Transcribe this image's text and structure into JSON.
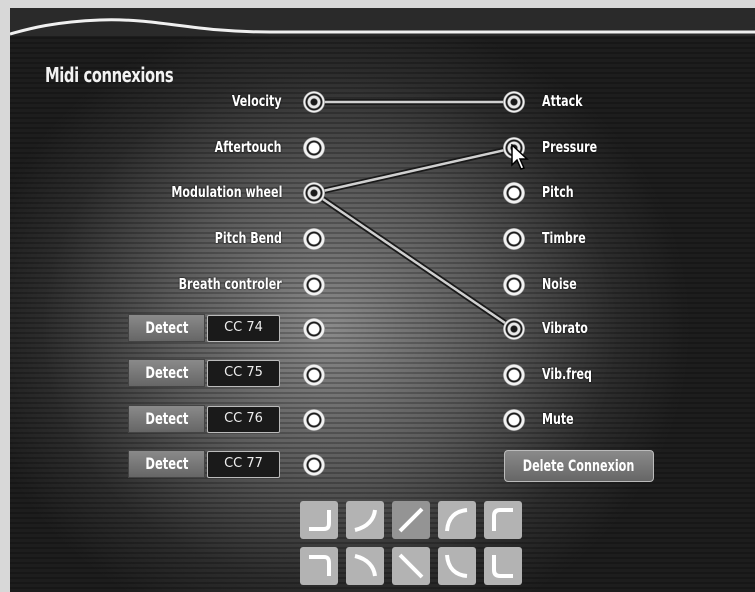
{
  "title": "Midi connexions",
  "sources": [
    {
      "label": "Velocity"
    },
    {
      "label": "Aftertouch"
    },
    {
      "label": "Modulation wheel"
    },
    {
      "label": "Pitch Bend"
    },
    {
      "label": "Breath controler"
    }
  ],
  "cc_rows": [
    {
      "detect_label": "Detect",
      "cc": "CC 74"
    },
    {
      "detect_label": "Detect",
      "cc": "CC 75"
    },
    {
      "detect_label": "Detect",
      "cc": "CC 76"
    },
    {
      "detect_label": "Detect",
      "cc": "CC 77"
    }
  ],
  "destinations": [
    {
      "label": "Attack"
    },
    {
      "label": "Pressure"
    },
    {
      "label": "Pitch"
    },
    {
      "label": "Timbre"
    },
    {
      "label": "Noise"
    },
    {
      "label": "Vibrato"
    },
    {
      "label": "Vib.freq"
    },
    {
      "label": "Mute"
    }
  ],
  "connections": [
    {
      "from": "Velocity",
      "to": "Attack"
    },
    {
      "from": "Modulation wheel",
      "to": "Pressure"
    },
    {
      "from": "Modulation wheel",
      "to": "Vibrato"
    }
  ],
  "delete_button": "Delete Connexion",
  "curve_shapes": {
    "selected": "linear-up",
    "row1": [
      "convex-up-hook",
      "concave-up",
      "linear-up",
      "arc-up",
      "rounded-corner-up"
    ],
    "row2": [
      "convex-down-hook",
      "concave-down",
      "linear-down",
      "arc-down",
      "rounded-corner-down"
    ]
  },
  "colors": {
    "panel_dark": "#1d1d1d",
    "label": "#ffffff",
    "button": "#777777",
    "curve_button": "#b3b3b3"
  }
}
